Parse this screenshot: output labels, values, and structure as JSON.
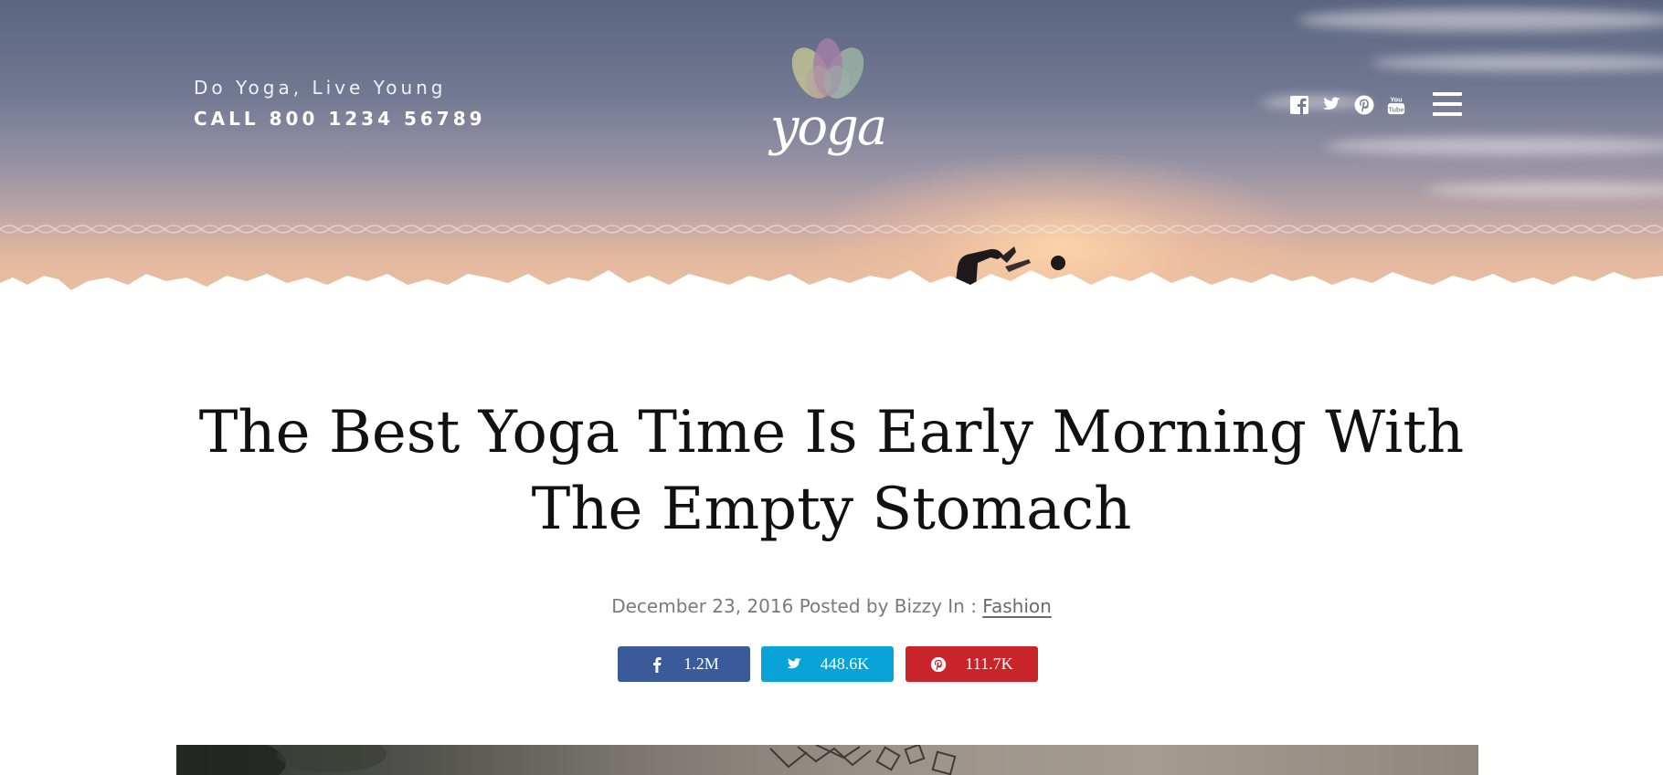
{
  "header": {
    "tagline": "Do Yoga, Live Young",
    "phone": "CALL 800 1234 56789",
    "logo_text": "yoga",
    "social_icons": [
      "facebook-icon",
      "twitter-icon",
      "pinterest-icon",
      "youtube-icon"
    ],
    "menu_icon": "hamburger-menu-icon"
  },
  "article": {
    "title": "The Best Yoga Time Is Early Morning With The Empty Stomach",
    "date": "December 23, 2016",
    "posted_by_label": "Posted by",
    "author": "Bizzy",
    "category_label": "In :",
    "category": "Fashion"
  },
  "share": {
    "facebook": {
      "count": "1.2M",
      "color": "#3b5a9a"
    },
    "twitter": {
      "count": "448.6K",
      "color": "#0aa3d8"
    },
    "pinterest": {
      "count": "111.7K",
      "color": "#c9242a"
    }
  }
}
